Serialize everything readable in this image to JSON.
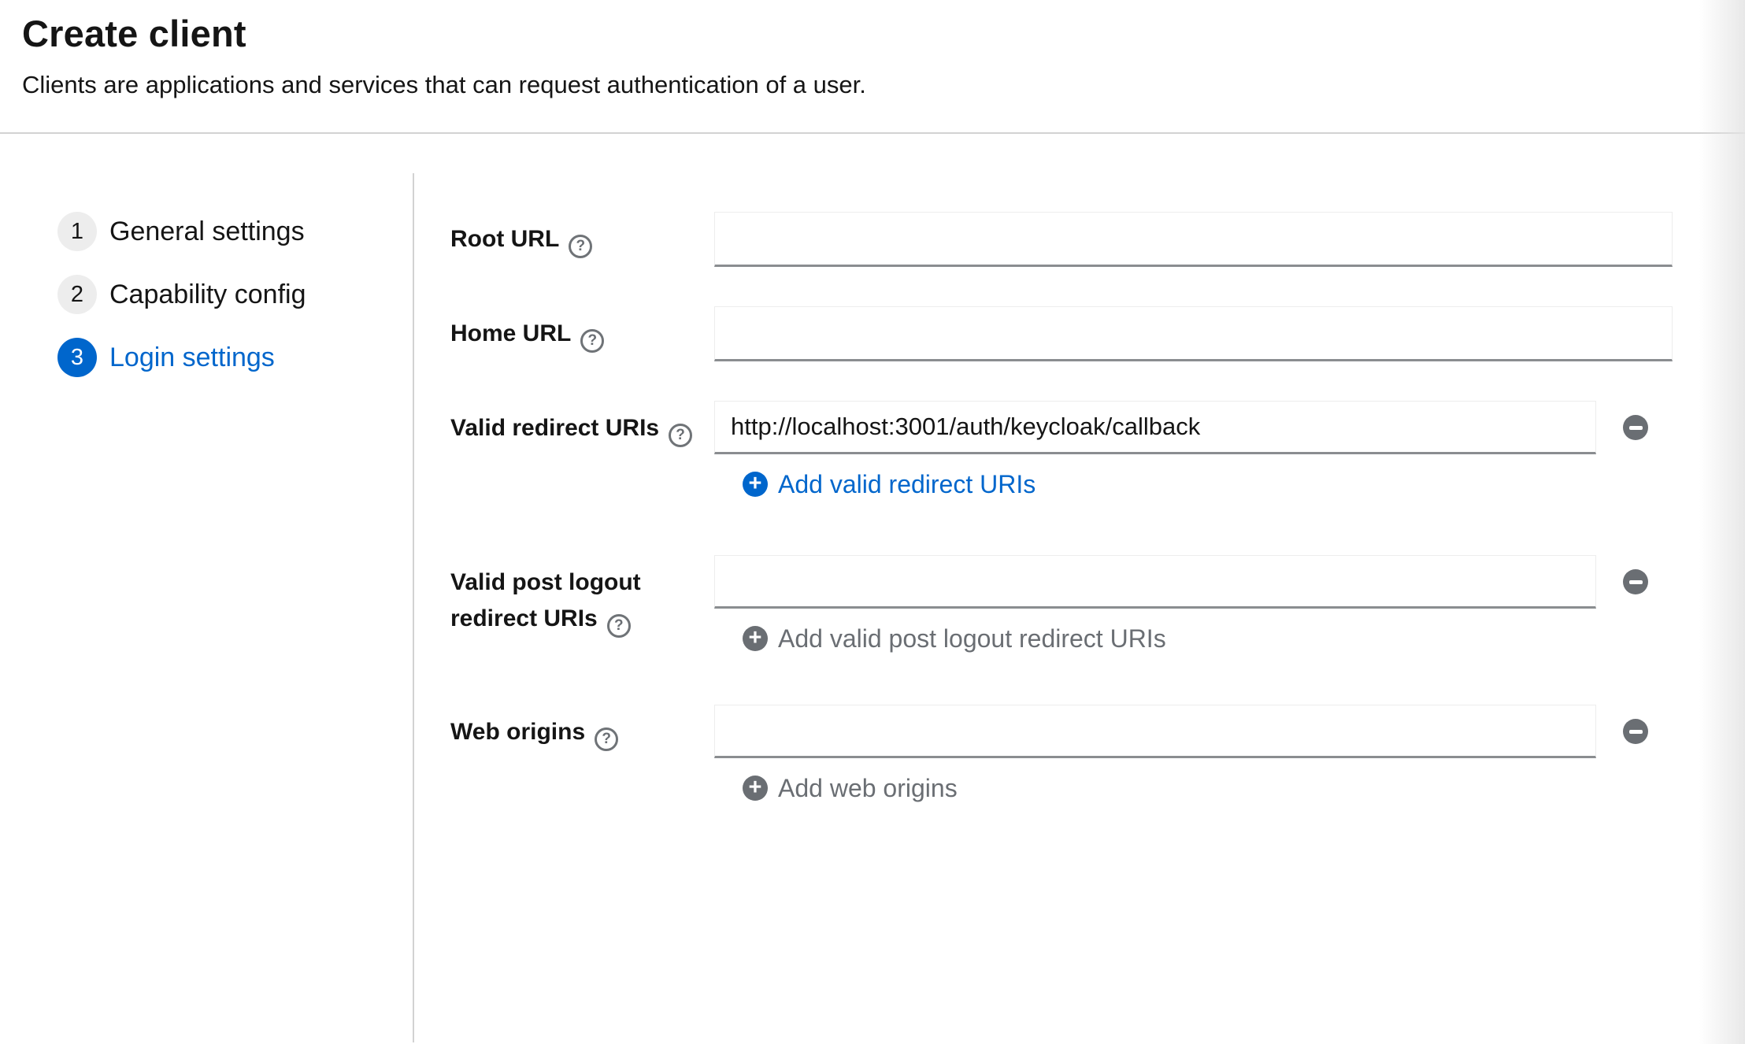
{
  "header": {
    "title": "Create client",
    "subtitle": "Clients are applications and services that can request authentication of a user."
  },
  "wizard": {
    "active_step": 3,
    "steps": [
      {
        "number": "1",
        "label": "General settings"
      },
      {
        "number": "2",
        "label": "Capability config"
      },
      {
        "number": "3",
        "label": "Login settings"
      }
    ]
  },
  "form": {
    "root_url": {
      "label": "Root URL",
      "value": ""
    },
    "home_url": {
      "label": "Home URL",
      "value": ""
    },
    "valid_redirect_uris": {
      "label": "Valid redirect URIs",
      "value": "http://localhost:3001/auth/keycloak/callback",
      "add_button": "Add valid redirect URIs"
    },
    "valid_post_logout_redirect_uris": {
      "label": "Valid post logout redirect URIs",
      "value": "",
      "add_button": "Add valid post logout redirect URIs"
    },
    "web_origins": {
      "label": "Web origins",
      "value": "",
      "add_button": "Add web origins"
    }
  },
  "icons": {
    "help_glyph": "?"
  },
  "colors": {
    "accent_blue": "#0066cc",
    "icon_gray": "#6a6e73",
    "divider_gray": "#d2d2d2",
    "input_bottom_border": "#8a8d90"
  }
}
